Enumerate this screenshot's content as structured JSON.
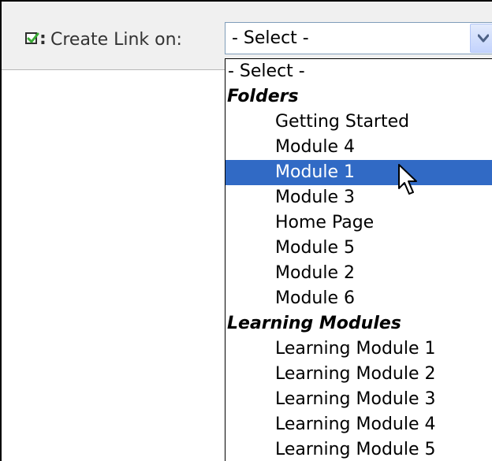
{
  "toolbar": {
    "label": "Create Link on:",
    "checkbox_icon": "checkbox-checked-icon",
    "checkbox_color": "#3aaa35"
  },
  "select": {
    "value": "- Select -",
    "arrow_icon": "chevron-down-icon"
  },
  "dropdown": {
    "selection_color": "#316ac5",
    "options": [
      {
        "label": "- Select -",
        "kind": "placeholder"
      },
      {
        "label": "Folders",
        "kind": "group"
      },
      {
        "label": "Getting Started",
        "kind": "child"
      },
      {
        "label": "Module 4",
        "kind": "child"
      },
      {
        "label": "Module 1",
        "kind": "child",
        "selected": true
      },
      {
        "label": "Module 3",
        "kind": "child"
      },
      {
        "label": "Home Page",
        "kind": "child"
      },
      {
        "label": "Module 5",
        "kind": "child"
      },
      {
        "label": "Module 2",
        "kind": "child"
      },
      {
        "label": "Module 6",
        "kind": "child"
      },
      {
        "label": "Learning Modules",
        "kind": "group"
      },
      {
        "label": "Learning Module 1",
        "kind": "child"
      },
      {
        "label": "Learning Module 2",
        "kind": "child"
      },
      {
        "label": "Learning Module 3",
        "kind": "child"
      },
      {
        "label": "Learning Module 4",
        "kind": "child"
      },
      {
        "label": "Learning Module 5",
        "kind": "child"
      }
    ]
  },
  "cursor_icon": "mouse-pointer-icon"
}
